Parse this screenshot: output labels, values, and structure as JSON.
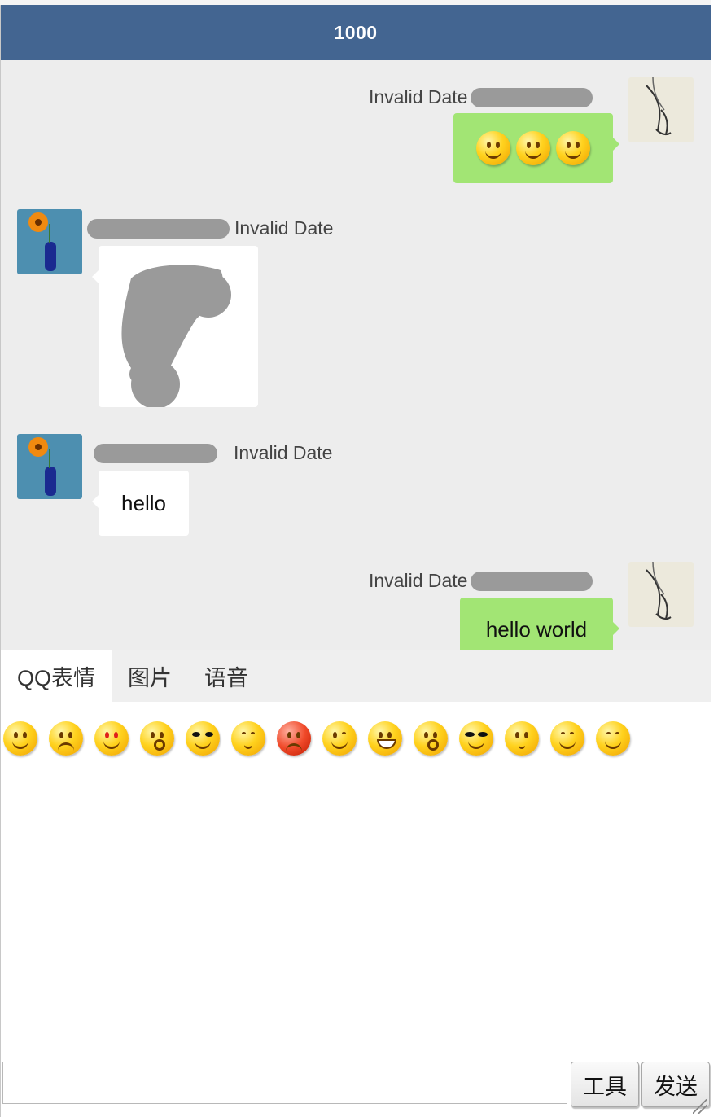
{
  "header": {
    "title": "1000"
  },
  "messages": [
    {
      "side": "right",
      "time": "Invalid Date",
      "content_type": "emoji",
      "emoji_count": 3
    },
    {
      "side": "left",
      "time": "Invalid Date",
      "content_type": "image"
    },
    {
      "side": "left",
      "time": "Invalid Date",
      "content_type": "text",
      "text": "hello"
    },
    {
      "side": "right",
      "time": "Invalid Date",
      "content_type": "text",
      "text": "hello world"
    }
  ],
  "tabs": [
    {
      "label": "QQ表情",
      "active": true
    },
    {
      "label": "图片",
      "active": false
    },
    {
      "label": "语音",
      "active": false
    }
  ],
  "emoji_panel": {
    "count": 14
  },
  "input": {
    "value": "",
    "placeholder": ""
  },
  "buttons": {
    "tools": "工具",
    "send": "发送"
  },
  "colors": {
    "header": "#436591",
    "my_bubble": "#a2e574",
    "chat_bg": "#ededed"
  }
}
